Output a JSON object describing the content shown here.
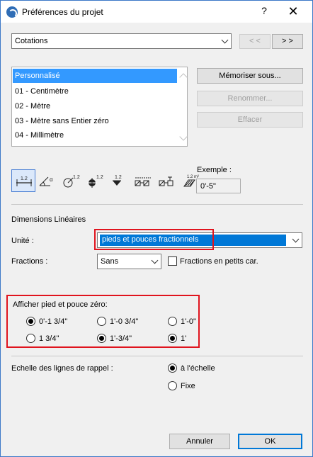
{
  "window": {
    "title": "Préférences du projet",
    "help": "?",
    "close": "✕"
  },
  "top": {
    "preset_value": "Cotations",
    "prev_label": "< <",
    "next_label": "> >"
  },
  "list": {
    "items": [
      {
        "label": "Personnalisé",
        "selected": true
      },
      {
        "label": "01 - Centimètre",
        "selected": false
      },
      {
        "label": "02 - Mètre",
        "selected": false
      },
      {
        "label": "03 - Mètre sans Entier zéro",
        "selected": false
      },
      {
        "label": "04 - Millimètre",
        "selected": false
      }
    ]
  },
  "actions": {
    "save_as": "Mémoriser sous...",
    "rename": "Renommer...",
    "delete": "Effacer"
  },
  "toolbar": {
    "icons": [
      {
        "name": "linear-dimension-icon",
        "caption": "1.2"
      },
      {
        "name": "angular-dimension-icon",
        "caption": "α"
      },
      {
        "name": "radial-dimension-icon",
        "caption": "1.2"
      },
      {
        "name": "level-dimension-icon",
        "caption": "1.2"
      },
      {
        "name": "elevation-dimension-icon",
        "caption": "1.2"
      },
      {
        "name": "door-window-dimension-icon",
        "caption": ""
      },
      {
        "name": "sill-height-icon",
        "caption": ""
      },
      {
        "name": "area-calculation-icon",
        "caption": "1.2 m²"
      }
    ]
  },
  "example": {
    "label": "Exemple :",
    "value": "0'-5\""
  },
  "linear": {
    "section_title": "Dimensions Linéaires",
    "unit_label": "Unité :",
    "unit_value": "pieds et pouces fractionnels",
    "fractions_label": "Fractions :",
    "fractions_value": "Sans",
    "small_fractions_label": "Fractions en petits car."
  },
  "zero": {
    "title": "Afficher pied et pouce zéro:",
    "options": [
      {
        "label": "0'-1 3/4\"",
        "checked": true
      },
      {
        "label": "1'-0 3/4\"",
        "checked": false
      },
      {
        "label": "1'-0\"",
        "checked": false
      },
      {
        "label": "1 3/4\"",
        "checked": false
      },
      {
        "label": "1'-3/4\"",
        "checked": true
      },
      {
        "label": "1'",
        "checked": true
      }
    ]
  },
  "scale": {
    "label": "Echelle des lignes de rappel :",
    "to_scale": "à l'échelle",
    "fixed": "Fixe",
    "selected": "to_scale"
  },
  "footer": {
    "cancel": "Annuler",
    "ok": "OK"
  },
  "colors": {
    "accent": "#0078d7",
    "selection": "#3399ff",
    "highlight_box": "#e0141e"
  }
}
